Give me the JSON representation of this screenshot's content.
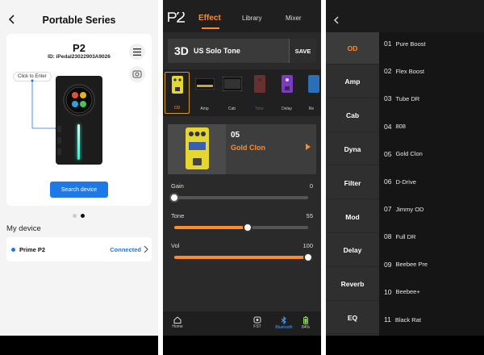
{
  "panel1": {
    "header_title": "Portable Series",
    "device_name": "P2",
    "device_id": "ID: iPedal23022903A9026",
    "click_to_enter": "Click to Enter",
    "search_button": "Search device",
    "my_device_label": "My device",
    "device_row": {
      "name": "Prime P2",
      "status": "Connected"
    },
    "pager": {
      "count": 2,
      "active": 1
    },
    "accent": "#1e78e6"
  },
  "panel2": {
    "logo": "P2",
    "tabs": [
      {
        "label": "Effect",
        "active": true
      },
      {
        "label": "Library",
        "active": false
      },
      {
        "label": "Mixer",
        "active": false
      }
    ],
    "preset": {
      "number": "3D",
      "name": "US Solo Tone",
      "save_label": "SAVE"
    },
    "chain": [
      {
        "label": "OD",
        "state": "active"
      },
      {
        "label": "Amp",
        "state": "on"
      },
      {
        "label": "Cab",
        "state": "on"
      },
      {
        "label": "Tone",
        "state": "off"
      },
      {
        "label": "Delay",
        "state": "on"
      },
      {
        "label": "Re",
        "state": "on"
      }
    ],
    "slot": {
      "number": "05",
      "name": "Gold Clon"
    },
    "params": [
      {
        "label": "Gain",
        "value": "0",
        "fraction": 0.0
      },
      {
        "label": "Tone",
        "value": "55",
        "fraction": 0.55
      },
      {
        "label": "Vol",
        "value": "100",
        "fraction": 1.0
      }
    ],
    "bottom": {
      "home": "Home",
      "fst": "FST",
      "bluetooth": "Bluetooth",
      "battery": "84%"
    },
    "accent": "#ff8a2a"
  },
  "panel3": {
    "categories": [
      {
        "label": "OD",
        "active": true
      },
      {
        "label": "Amp",
        "active": false
      },
      {
        "label": "Cab",
        "active": false
      },
      {
        "label": "Dyna",
        "active": false
      },
      {
        "label": "Filter",
        "active": false
      },
      {
        "label": "Mod",
        "active": false
      },
      {
        "label": "Delay",
        "active": false
      },
      {
        "label": "Reverb",
        "active": false
      },
      {
        "label": "EQ",
        "active": false
      }
    ],
    "items": [
      {
        "num": "01",
        "name": "Pure Boost"
      },
      {
        "num": "02",
        "name": "Flex Boost"
      },
      {
        "num": "03",
        "name": "Tube DR"
      },
      {
        "num": "04",
        "name": "808"
      },
      {
        "num": "05",
        "name": "Gold Clon"
      },
      {
        "num": "06",
        "name": "D-Drive"
      },
      {
        "num": "07",
        "name": "Jimmy OD"
      },
      {
        "num": "08",
        "name": "Full DR"
      },
      {
        "num": "09",
        "name": "Beebee Pre"
      },
      {
        "num": "10",
        "name": "Beebee+"
      },
      {
        "num": "11",
        "name": "Black Rat"
      }
    ]
  }
}
